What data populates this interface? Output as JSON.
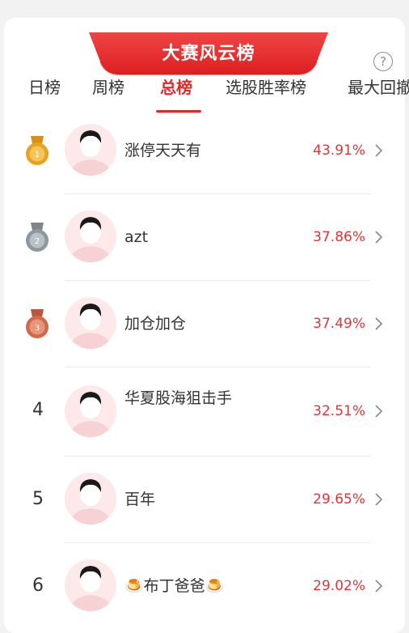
{
  "header": {
    "title": "大赛风云榜",
    "help_symbol": "?"
  },
  "tabs": [
    {
      "label": "日榜",
      "active": false
    },
    {
      "label": "周榜",
      "active": false
    },
    {
      "label": "总榜",
      "active": true
    },
    {
      "label": "选股胜率榜",
      "active": false
    },
    {
      "label": "最大回撤",
      "active": false
    }
  ],
  "rows": [
    {
      "rank": "1",
      "medal": "gold",
      "name": "涨停天天有",
      "percent": "43.91%"
    },
    {
      "rank": "2",
      "medal": "silver",
      "name": "azt",
      "percent": "37.86%"
    },
    {
      "rank": "3",
      "medal": "bronze",
      "name": "加仓加仓",
      "percent": "37.49%"
    },
    {
      "rank": "4",
      "medal": null,
      "name": "华夏股海狙击手",
      "percent": "32.51%"
    },
    {
      "rank": "5",
      "medal": null,
      "name": "百年",
      "percent": "29.65%"
    },
    {
      "rank": "6",
      "medal": null,
      "name": "🍮布丁爸爸🍮",
      "percent": "29.02%"
    }
  ],
  "colors": {
    "accent": "#e02a2a",
    "percent": "#d9383a",
    "gold": "#e6a321",
    "silver": "#8e979f",
    "bronze": "#cf6b4b"
  }
}
